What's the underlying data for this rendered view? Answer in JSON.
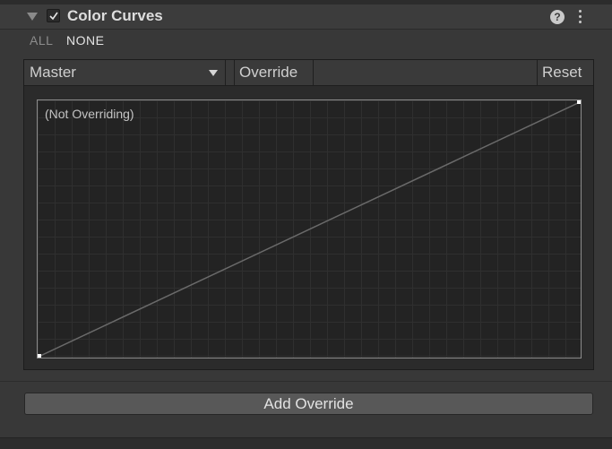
{
  "component": {
    "title": "Color Curves",
    "enabled": true,
    "help_icon": "help-icon",
    "menu_icon": "more-vertical-icon",
    "help_glyph": "?"
  },
  "toggles": {
    "all_label": "ALL",
    "none_label": "NONE"
  },
  "curve_toolbar": {
    "curve_select": "Master",
    "override_label": "Override",
    "reset_label": "Reset"
  },
  "curve_editor": {
    "status_text": "(Not Overriding)",
    "curve_color": "#6a6a6a",
    "keyframe_color": "#ffffff"
  },
  "footer": {
    "add_override_label": "Add Override"
  }
}
